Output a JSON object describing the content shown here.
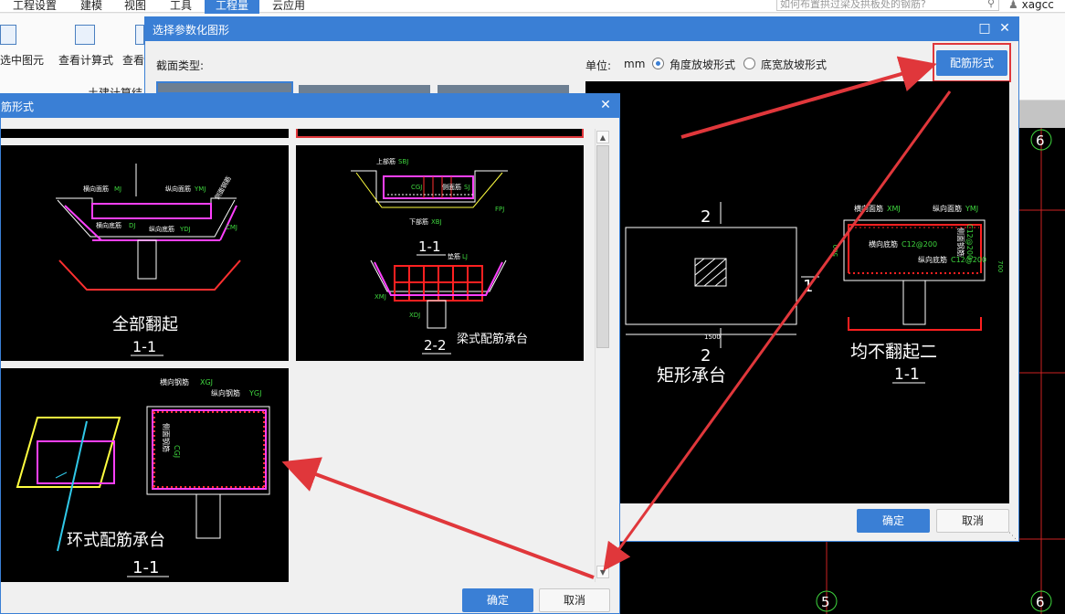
{
  "menu": {
    "items": [
      "工程设置",
      "建模",
      "视图",
      "工具",
      "工程量",
      "云应用"
    ],
    "active_index": 4,
    "search_placeholder": "如何布置拱过梁及拱板处的钢筋?",
    "user": "xagcc"
  },
  "ribbon": {
    "select_element": "选中图元",
    "view_formula": "查看计算式",
    "view_formula2": "查看",
    "civil_calc": "土建计算结"
  },
  "dialog_select": {
    "title": "选择参数化图形",
    "section_type_label": "截面类型:",
    "unit_label": "单位:",
    "unit_value": "mm",
    "radio_angle": "角度放坡形式",
    "radio_width": "底宽放坡形式",
    "radio_selected": "angle",
    "rebar_form_button": "配筋形式",
    "ok": "确定",
    "cancel": "取消"
  },
  "preview": {
    "rect_label": "矩形承台",
    "section_mark_top": "2",
    "section_mark_bottom": "2",
    "section_mark_side": "1",
    "dimension": "1500",
    "right_title": "均不翻起二",
    "right_sub": "1-1",
    "bar_hx": "横向面筋",
    "bar_hx_code": "XMJ",
    "bar_zx": "纵向面筋",
    "bar_zx_code": "YMJ",
    "bar_hd": "横向底筋",
    "bar_hd_code": "C12@200",
    "bar_zd": "纵向底筋",
    "bar_zd_code": "C12@200",
    "side_bar": "侧面钢筋",
    "side_bar_code": "C12@200",
    "dim_h": "500",
    "dim_c": "700"
  },
  "dialog_rebar": {
    "title": "筋形式",
    "ok": "确定",
    "cancel": "取消",
    "thumbs": [
      {
        "title": "全部翻起",
        "sub": "1-1",
        "labels": [
          "横向面筋",
          "MJ",
          "纵向面筋",
          "YMJ",
          "横向底筋",
          "DJ",
          "纵向底筋",
          "YDJ",
          "CMJ",
          "侧面钢筋"
        ]
      },
      {
        "title": "梁式配筋承台",
        "sub1": "1-1",
        "sub2": "2-2",
        "labels": [
          "上部筋",
          "SBJ",
          "CGJ",
          "侧面筋",
          "SJ",
          "下部筋",
          "XBJ",
          "FPJ",
          "垫筋",
          "LJ",
          "XMJ",
          "XDJ"
        ]
      },
      {
        "title": "环式配筋承台",
        "sub": "1-1",
        "labels": [
          "横向钢筋",
          "XGJ",
          "纵向钢筋",
          "YGJ",
          "侧面钢筋",
          "CGJ"
        ]
      }
    ]
  },
  "colors": {
    "accent": "#3a7fd5",
    "highlight": "#e0373b",
    "cad_bg": "#000000"
  }
}
